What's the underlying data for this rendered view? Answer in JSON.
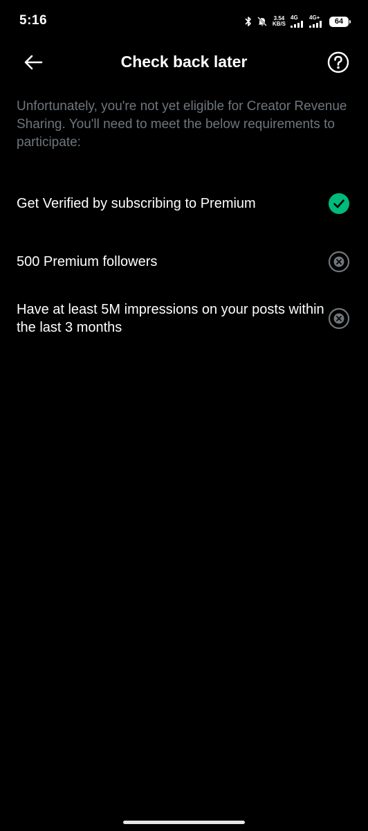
{
  "status_bar": {
    "time": "5:16",
    "net_speed_value": "3.54",
    "net_speed_unit": "KB/S",
    "signal_1_label": "4G",
    "signal_2_label": "4G+",
    "battery_level": "64",
    "icons": [
      "bluetooth-icon",
      "mute-bell-icon",
      "signal-icon",
      "signal-icon",
      "battery-icon"
    ]
  },
  "header": {
    "title": "Check back later",
    "back_icon": "arrow-left-icon",
    "help_icon": "question-circle-icon"
  },
  "intro_text": "Unfortunately, you're not yet eligible for Creator Revenue Sharing. You'll need to meet the below requirements to participate:",
  "requirements": [
    {
      "label": "Get Verified by subscribing to Premium",
      "met": true,
      "icon": "check-circle-icon"
    },
    {
      "label": "500 Premium followers",
      "met": false,
      "icon": "x-circle-icon"
    },
    {
      "label": "Have at least 5M impressions on your posts within the last 3 months",
      "met": false,
      "icon": "x-circle-icon"
    }
  ],
  "colors": {
    "background": "#000000",
    "text_primary": "#ffffff",
    "text_secondary": "#6e767d",
    "met_green": "#00ba7c",
    "unmet_grey": "#71767b"
  }
}
